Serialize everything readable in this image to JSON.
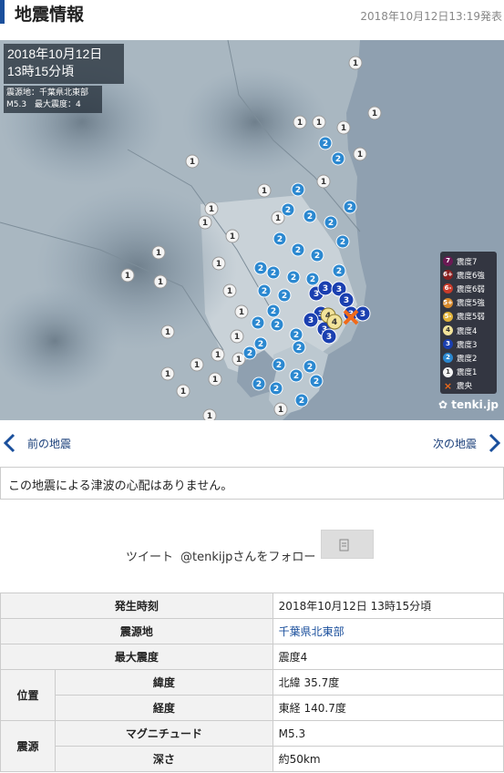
{
  "header": {
    "title": "地震情報",
    "updated": "2018年10月12日13:19発表"
  },
  "map": {
    "datetime_line1": "2018年10月12日",
    "datetime_line2": "13時15分頃",
    "epicenter_label": "震源地：千葉県北東部",
    "magnitude_label": "M5.3",
    "max_intensity_label": "最大震度：4",
    "legend": [
      {
        "symbol": "7",
        "label": "震度7",
        "color": "#6b1a54"
      },
      {
        "symbol": "6+",
        "label": "震度6強",
        "color": "#8b1f1f"
      },
      {
        "symbol": "6-",
        "label": "震度6弱",
        "color": "#c83b2a"
      },
      {
        "symbol": "5+",
        "label": "震度5強",
        "color": "#d88a2c"
      },
      {
        "symbol": "5-",
        "label": "震度5弱",
        "color": "#e2b33a"
      },
      {
        "symbol": "4",
        "label": "震度4",
        "color": "#f2e39a"
      },
      {
        "symbol": "3",
        "label": "震度3",
        "color": "#1a3fb0"
      },
      {
        "symbol": "2",
        "label": "震度2",
        "color": "#2b88d0"
      },
      {
        "symbol": "1",
        "label": "震度1",
        "color": "#f4f4f4"
      },
      {
        "symbol": "×",
        "label": "震央",
        "color": "#f06a1a"
      }
    ],
    "logo": "tenki.jp"
  },
  "nav": {
    "prev_label": "前の地震",
    "next_label": "次の地震"
  },
  "tsunami_message": "この地震による津波の心配はありません。",
  "share": {
    "tweet_label": "ツイート",
    "follow_label": "@tenkijpさんをフォロー"
  },
  "table": {
    "occurrence_header": "発生時刻",
    "occurrence_value": "2018年10月12日 13時15分頃",
    "epicenter_header": "震源地",
    "epicenter_value": "千葉県北東部",
    "max_intensity_header": "最大震度",
    "max_intensity_value": "震度4",
    "position_header": "位置",
    "latitude_header": "緯度",
    "latitude_value": "北緯 35.7度",
    "longitude_header": "経度",
    "longitude_value": "東経 140.7度",
    "source_header": "震源",
    "magnitude_header": "マグニチュード",
    "magnitude_value": "M5.3",
    "depth_header": "深さ",
    "depth_value": "約50km"
  }
}
